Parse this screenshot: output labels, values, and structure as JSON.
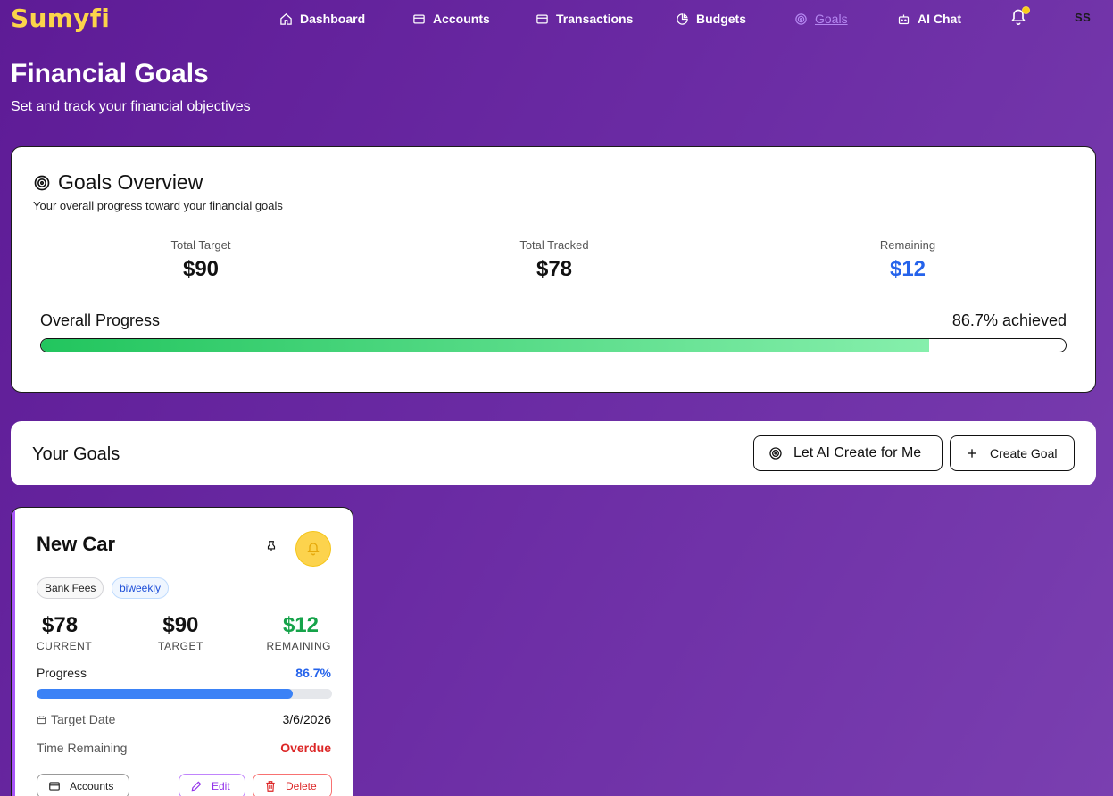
{
  "app": {
    "logo": "Sumyfi",
    "avatar_initials": "SS"
  },
  "nav": [
    {
      "label": "Dashboard",
      "icon": "home-icon"
    },
    {
      "label": "Accounts",
      "icon": "card-icon"
    },
    {
      "label": "Transactions",
      "icon": "card-icon"
    },
    {
      "label": "Budgets",
      "icon": "pie-icon"
    },
    {
      "label": "Goals",
      "icon": "target-icon",
      "active": true
    },
    {
      "label": "AI Chat",
      "icon": "bot-icon"
    }
  ],
  "header": {
    "title": "Financial Goals",
    "subtitle": "Set and track your financial objectives"
  },
  "overview": {
    "title": "Goals Overview",
    "description": "Your overall progress toward your financial goals",
    "total_target_label": "Total Target",
    "total_target": "$90",
    "total_tracked_label": "Total Tracked",
    "total_tracked": "$78",
    "remaining_label": "Remaining",
    "remaining": "$12",
    "progress_label": "Overall Progress",
    "progress_text": "86.7% achieved",
    "progress_fraction": 0.867
  },
  "goals_section": {
    "title": "Your Goals",
    "ai_button": "Let AI Create for Me",
    "create_button": "Create Goal"
  },
  "goal": {
    "name": "New Car",
    "category": "Bank Fees",
    "frequency": "biweekly",
    "current": "$78",
    "current_label": "CURRENT",
    "target": "$90",
    "target_label": "TARGET",
    "remaining": "$12",
    "remaining_label": "REMAINING",
    "progress_label": "Progress",
    "progress_pct": "86.7%",
    "progress_fraction": 0.867,
    "target_date_label": "Target Date",
    "target_date": "3/6/2026",
    "time_remaining_label": "Time Remaining",
    "time_remaining": "Overdue",
    "accounts_button": "Accounts",
    "edit_button": "Edit",
    "delete_button": "Delete"
  },
  "colors": {
    "accent_purple": "#a855f7",
    "logo_yellow": "#fbd44a",
    "progress_blue": "#3b82f6",
    "success_green": "#16a34a",
    "danger_red": "#dc2626"
  }
}
